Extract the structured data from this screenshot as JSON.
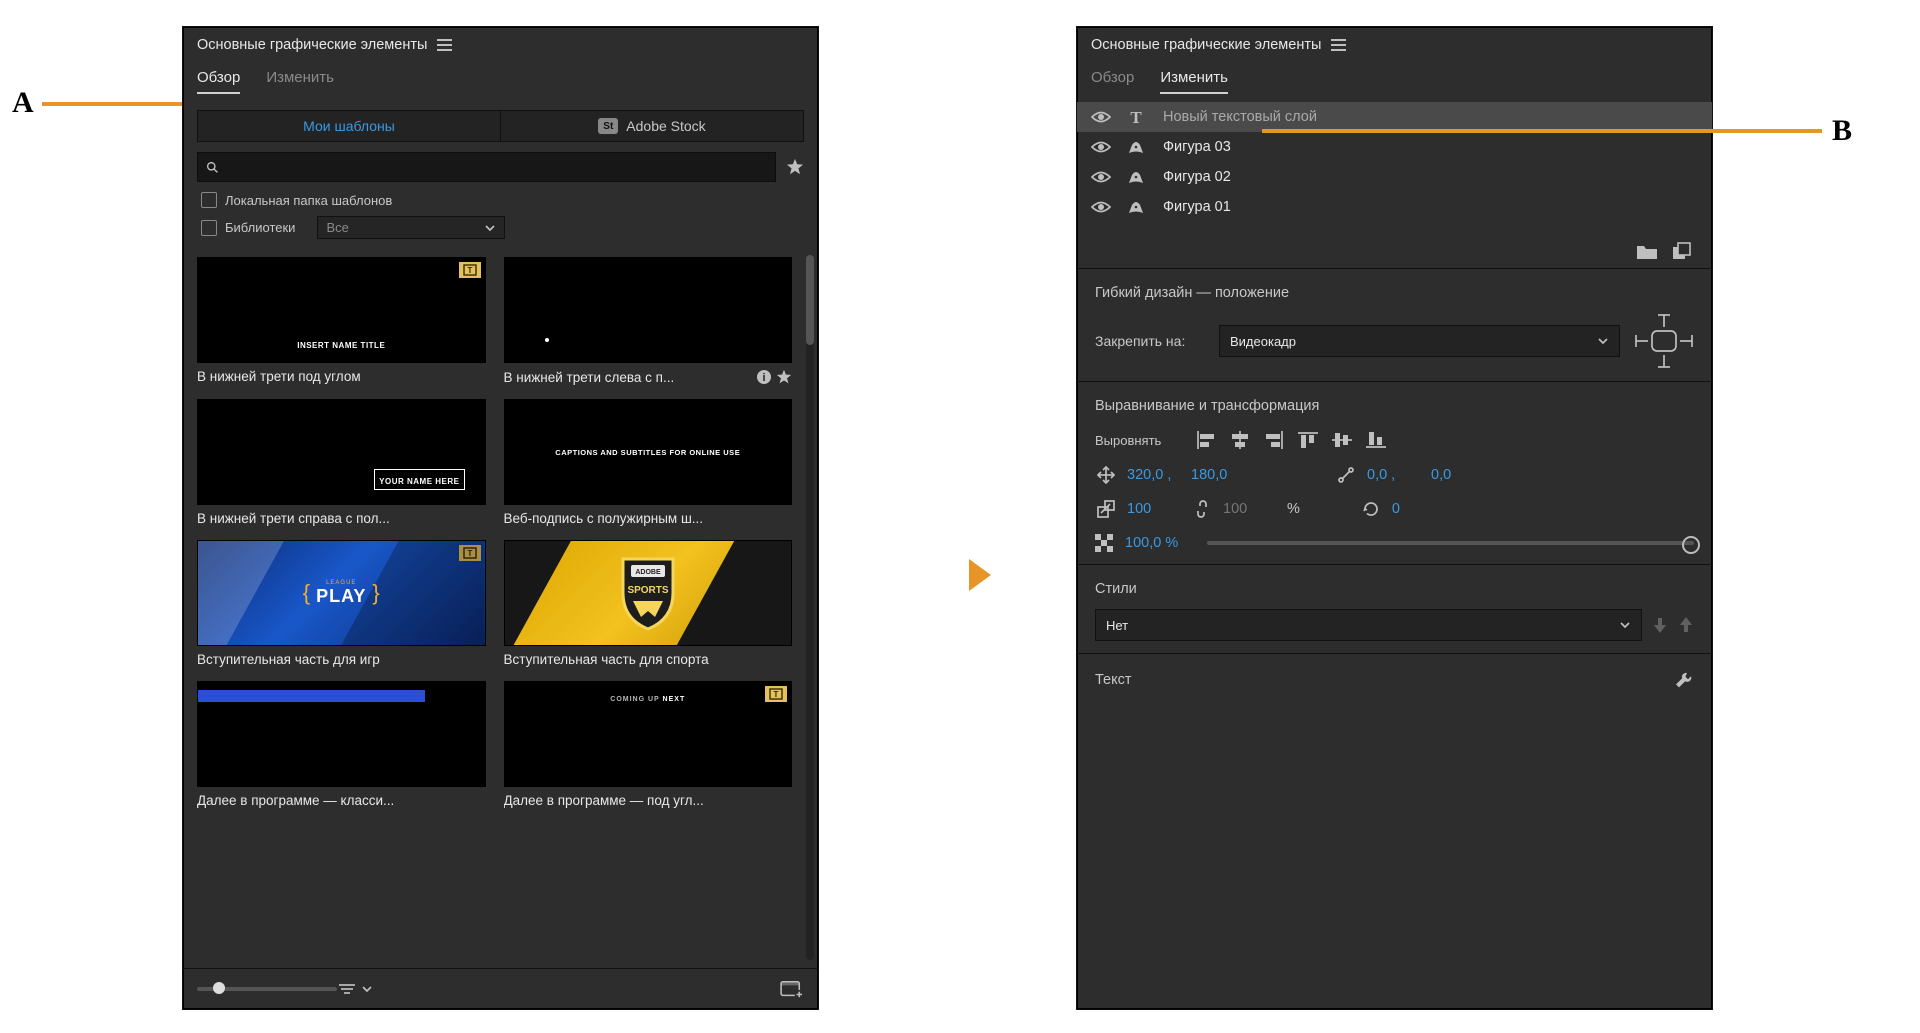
{
  "callouts": {
    "a": "A",
    "b": "B"
  },
  "leftPanel": {
    "title": "Основные графические элементы",
    "tabs": {
      "browse": "Обзор",
      "edit": "Изменить"
    },
    "sources": {
      "myTemplates": "Мои шаблоны",
      "adobeStock": "Adobe Stock",
      "stockBadge": "St"
    },
    "search": {
      "placeholder": ""
    },
    "checks": {
      "localFolder": "Локальная папка шаблонов",
      "libraries": "Библиотеки",
      "libFilter": "Все"
    },
    "templates": [
      {
        "label": "В нижней трети под углом",
        "thumbText": "INSERT NAME TITLE",
        "badge": true,
        "style": "black"
      },
      {
        "label": "В нижней трети слева с п...",
        "thumbText": "",
        "badge": false,
        "style": "black",
        "info": true
      },
      {
        "label": "В нижней трети справа с пол...",
        "thumbText": "YOUR NAME HERE",
        "badge": false,
        "style": "black-right"
      },
      {
        "label": "Веб-подпись с полужирным ш...",
        "thumbText": "CAPTIONS AND SUBTITLES FOR ONLINE USE",
        "badge": false,
        "style": "black-center"
      },
      {
        "label": "Вступительная часть для игр",
        "thumbText": "PLAY",
        "badge": true,
        "style": "play"
      },
      {
        "label": "Вступительная часть для спорта",
        "thumbText": "ADOBE SPORTS",
        "badge": true,
        "style": "sports"
      },
      {
        "label": "Далее в программе — класси...",
        "thumbText": "",
        "badge": false,
        "style": "blue-strip"
      },
      {
        "label": "Далее в программе — под угл...",
        "thumbText": "COMING UP NEXT",
        "badge": true,
        "style": "black-top"
      }
    ]
  },
  "rightPanel": {
    "title": "Основные графические элементы",
    "tabs": {
      "browse": "Обзор",
      "edit": "Изменить"
    },
    "layers": [
      {
        "name": "Новый текстовый слой",
        "type": "text",
        "selected": true
      },
      {
        "name": "Фигура 03",
        "type": "shape",
        "selected": false
      },
      {
        "name": "Фигура 02",
        "type": "shape",
        "selected": false
      },
      {
        "name": "Фигура 01",
        "type": "shape",
        "selected": false
      }
    ],
    "responsive": {
      "title": "Гибкий дизайн — положение",
      "pinLabel": "Закрепить на:",
      "pinValue": "Видеокадр"
    },
    "alignTransform": {
      "title": "Выравнивание и трансформация",
      "alignLabel": "Выровнять",
      "posX": "320,0 ,",
      "posY": "180,0",
      "anchorX": "0,0 ,",
      "anchorY": "0,0",
      "scale": "100",
      "scaleLinked": "100",
      "scaleUnit": "%",
      "rotation": "0",
      "opacity": "100,0 %"
    },
    "styles": {
      "title": "Стили",
      "value": "Нет"
    },
    "textSection": {
      "title": "Текст"
    }
  }
}
